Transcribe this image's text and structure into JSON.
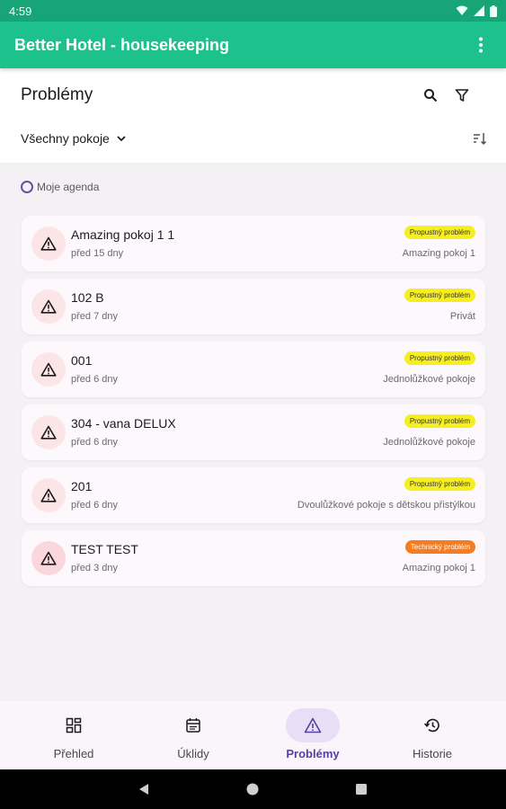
{
  "status_bar": {
    "time": "4:59"
  },
  "app_bar": {
    "title": "Better Hotel - housekeeping",
    "menu_icon": "more-vert-icon"
  },
  "header": {
    "title": "Problémy",
    "filter_label": "Všechny pokoje",
    "icons": [
      "search-icon",
      "filter-icon",
      "sort-icon"
    ]
  },
  "agenda": {
    "label": "Moje agenda"
  },
  "problems": [
    {
      "name": "Amazing pokoj 1 1",
      "age": "před 15 dny",
      "badge": "Propustný problém",
      "badge_type": "propustny",
      "room_type": "Amazing pokoj 1"
    },
    {
      "name": "102 B",
      "age": "před 7 dny",
      "badge": "Propustný problém",
      "badge_type": "propustny",
      "room_type": "Privát"
    },
    {
      "name": "001",
      "age": "před 6 dny",
      "badge": "Propustný problém",
      "badge_type": "propustny",
      "room_type": "Jednolůžkové pokoje"
    },
    {
      "name": "304 - vana DELUX",
      "age": "před 6 dny",
      "badge": "Propustný problém",
      "badge_type": "propustny",
      "room_type": "Jednolůžkové pokoje"
    },
    {
      "name": "201",
      "age": "před 6 dny",
      "badge": "Propustný problém",
      "badge_type": "propustny",
      "room_type": "Dvoulůžkové pokoje s dětskou přistýlkou"
    },
    {
      "name": "TEST TEST",
      "age": "před 3 dny",
      "badge": "Technický problém",
      "badge_type": "technicky",
      "room_type": "Amazing pokoj 1"
    }
  ],
  "bottom_nav": {
    "items": [
      {
        "label": "Přehled",
        "icon": "dashboard-icon",
        "active": false
      },
      {
        "label": "Úklidy",
        "icon": "calendar-icon",
        "active": false
      },
      {
        "label": "Problémy",
        "icon": "warning-icon",
        "active": true
      },
      {
        "label": "Historie",
        "icon": "history-icon",
        "active": false
      }
    ]
  },
  "colors": {
    "app_bar": "#1cc18b",
    "accent": "#5a3ea1",
    "badge_propustny": "#f6ee1f",
    "badge_technicky": "#f57c21"
  }
}
